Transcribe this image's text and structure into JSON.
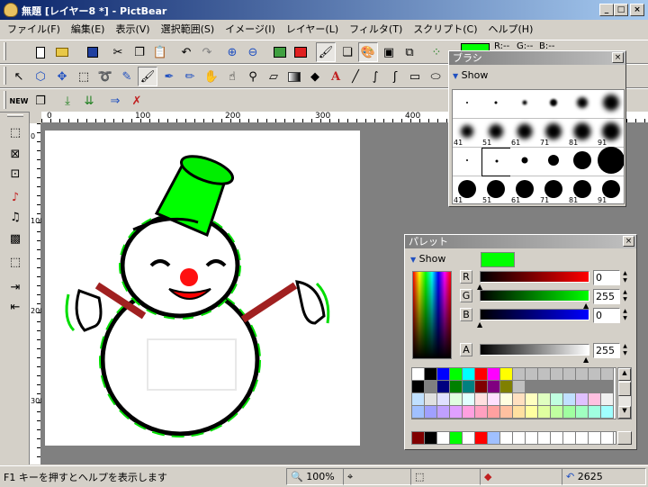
{
  "window": {
    "title": "無題 [レイヤー8 *] - PictBear"
  },
  "menu": [
    "ファイル(F)",
    "編集(E)",
    "表示(V)",
    "選択範囲(S)",
    "イメージ(I)",
    "レイヤー(L)",
    "フィルタ(T)",
    "スクリプト(C)",
    "ヘルプ(H)"
  ],
  "toolbar1": {
    "rgb_labels": [
      "R:--",
      "G:--",
      "B:--"
    ]
  },
  "ruler": {
    "top_ticks": [
      "0",
      "100",
      "200",
      "300",
      "400"
    ],
    "left_ticks": [
      "0",
      "100",
      "200",
      "300"
    ]
  },
  "brush_panel": {
    "title": "ブラシ",
    "show_label": "Show",
    "sizes": [
      "41",
      "51",
      "61",
      "71",
      "81",
      "91"
    ]
  },
  "palette_panel": {
    "title": "パレット",
    "show_label": "Show",
    "channels": [
      {
        "label": "R",
        "value": "0",
        "color": "#ff0000"
      },
      {
        "label": "G",
        "value": "255",
        "color": "#00ff00"
      },
      {
        "label": "B",
        "value": "0",
        "color": "#0000ff"
      }
    ],
    "alpha": {
      "label": "A",
      "value": "255"
    },
    "current_color": "#00ff00"
  },
  "status": {
    "help": "F1 キーを押すとヘルプを表示します",
    "zoom": "100%",
    "history": "2625"
  }
}
